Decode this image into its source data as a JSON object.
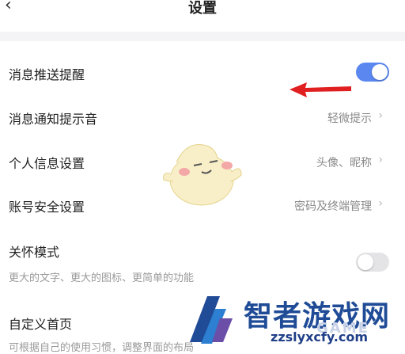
{
  "header": {
    "title": "设置",
    "back_icon": "back-chevron-icon"
  },
  "settings": {
    "push": {
      "label": "消息推送提醒",
      "enabled": true
    },
    "sound": {
      "label": "消息通知提示音",
      "value": "轻微提示"
    },
    "profile": {
      "label": "个人信息设置",
      "value": "头像、昵称"
    },
    "security": {
      "label": "账号安全设置",
      "value": "密码及终端管理"
    },
    "care": {
      "label": "关怀模式",
      "desc": "更大的文字、更大的图标、更简单的功能",
      "enabled": false
    },
    "home": {
      "label": "自定义首页",
      "desc": "可根据自己的使用习惯，调整界面的布局"
    }
  },
  "colors": {
    "toggle_on": "#5b87f0",
    "toggle_off": "#e4e4e6",
    "arrow": "#e02020"
  },
  "watermark": {
    "title": "智者游戏网",
    "url": "zzslyxcfy.com",
    "game": "GAME"
  }
}
